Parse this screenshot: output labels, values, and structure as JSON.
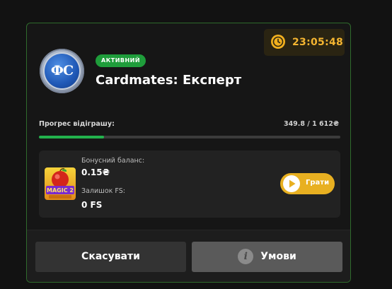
{
  "bonus": {
    "timer": "23:05:48",
    "coin_text": "ФС",
    "status_badge": "АКТИВНИЙ",
    "title": "Cardmates: Експерт",
    "progress": {
      "label": "Прогрес відіграшу:",
      "value_text": "349.8 / 1 612₴",
      "fraction": 0.217
    },
    "details": {
      "bonus_balance_label": "Бонусний баланс:",
      "bonus_balance_value": "0.15₴",
      "fs_label": "Залишок FS:",
      "fs_value": "0 FS",
      "play_label": "Грати",
      "game_name": "Magic Apple 2 Hold and Win"
    },
    "footer": {
      "cancel_label": "Скасувати",
      "terms_label": "Умови"
    }
  },
  "colors": {
    "accent_green": "#22b24c",
    "accent_gold": "#e8b021",
    "card_border": "#2f6b2c"
  },
  "icons": {
    "timer": "clock-icon",
    "play": "play-icon",
    "info": "info-icon"
  }
}
